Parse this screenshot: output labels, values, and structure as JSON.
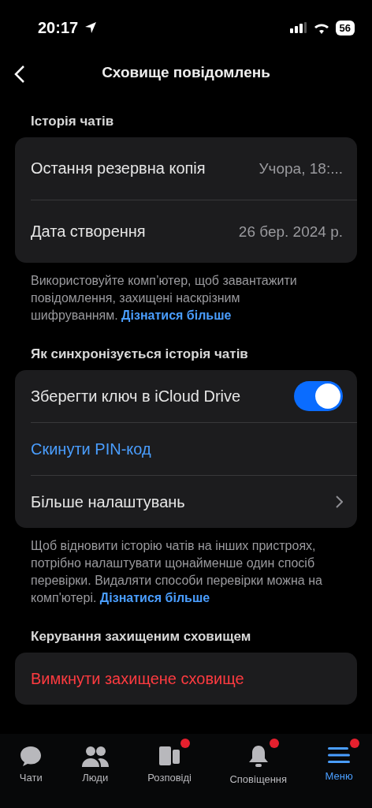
{
  "status_bar": {
    "time": "20:17",
    "battery": "56"
  },
  "header": {
    "title": "Сховище повідомлень"
  },
  "sections": [
    {
      "title": "Історія чатів",
      "rows": [
        {
          "kind": "value",
          "label": "Остання резервна копія",
          "value": "Учора, 18:..."
        },
        {
          "kind": "value",
          "label": "Дата створення",
          "value": "26 бер. 2024 р."
        }
      ],
      "footnote": "Використовуйте комп’ютер, щоб завантажити повідомлення, захищені наскрізним шифруванням.",
      "link": "Дізнатися більше"
    },
    {
      "title": "Як синхронізується історія чатів",
      "rows": [
        {
          "kind": "toggle",
          "label": "Зберегти ключ в iCloud Drive",
          "on": true
        },
        {
          "kind": "action",
          "label": "Скинути PIN-код"
        },
        {
          "kind": "nav",
          "label": "Більше налаштувань"
        }
      ],
      "footnote": "Щоб відновити історію чатів на інших пристроях, потрібно налаштувати щонайменше один спосіб перевірки. Видаляти способи перевірки можна на комп'ютері.",
      "link": "Дізнатися більше"
    },
    {
      "title": "Керування захищеним сховищем",
      "rows": [
        {
          "kind": "danger",
          "label": "Вимкнути захищене сховище"
        }
      ]
    }
  ],
  "tabs": [
    {
      "label": "Чати",
      "badge": false,
      "selected": false
    },
    {
      "label": "Люди",
      "badge": false,
      "selected": false
    },
    {
      "label": "Розповіді",
      "badge": true,
      "selected": false
    },
    {
      "label": "Сповіщення",
      "badge": true,
      "selected": false
    },
    {
      "label": "Меню",
      "badge": true,
      "selected": true
    }
  ]
}
